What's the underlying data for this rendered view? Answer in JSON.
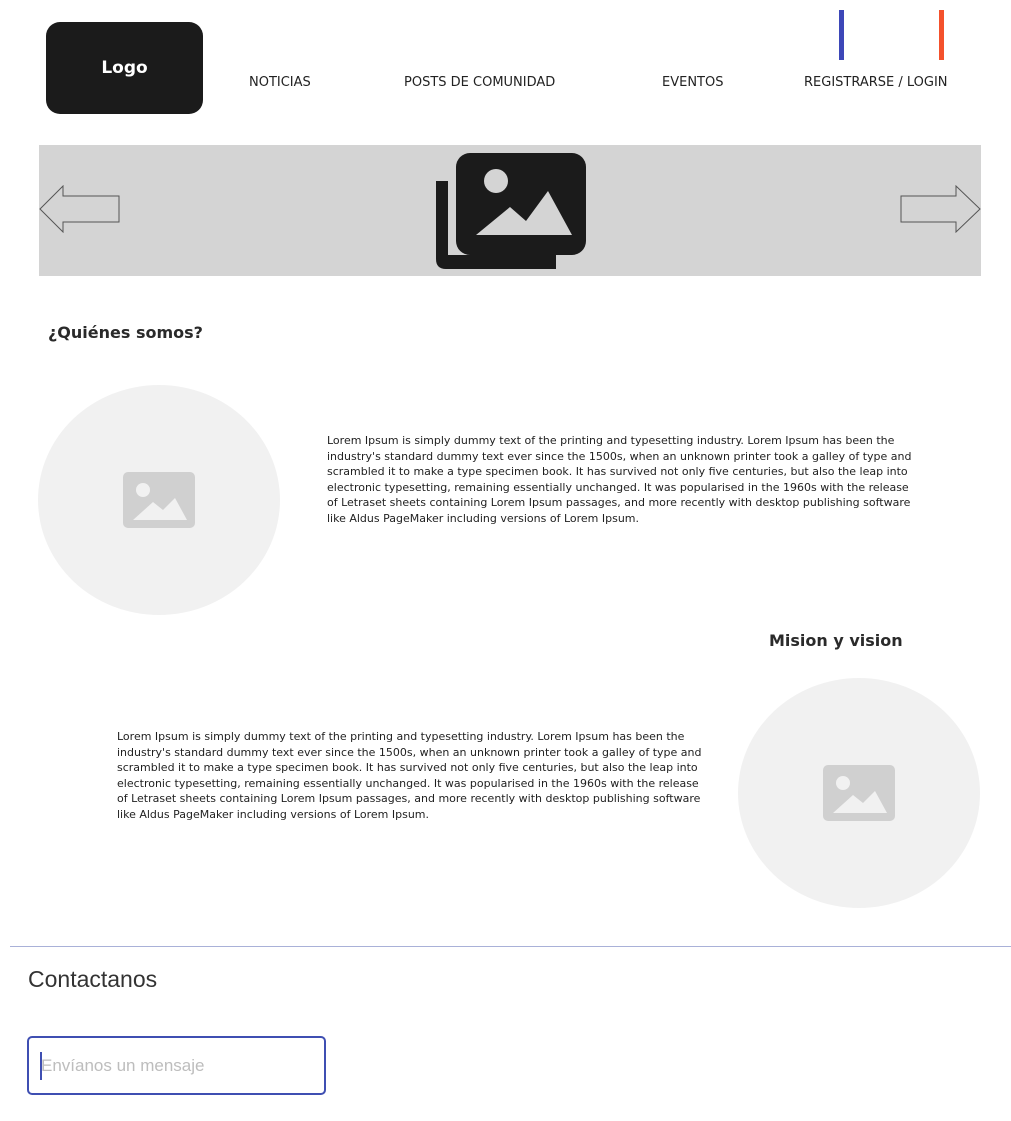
{
  "header": {
    "logo_label": "Logo",
    "nav": [
      {
        "label": "NOTICIAS"
      },
      {
        "label": "POSTS DE COMUNIDAD"
      },
      {
        "label": "EVENTOS"
      },
      {
        "label": "REGISTRARSE / LOGIN"
      }
    ],
    "accent_colors": [
      "#3d47b8",
      "#f4512c"
    ]
  },
  "carousel": {
    "prev_icon": "arrow-left-outline-icon",
    "next_icon": "arrow-right-outline-icon",
    "image_icon": "photo-library-icon",
    "background": "#d4d4d4"
  },
  "about": {
    "title": "¿Quiénes somos?",
    "text": "Lorem Ipsum is simply dummy text of the printing and typesetting industry. Lorem Ipsum has been the industry's standard dummy text ever since the 1500s, when an unknown printer took a galley of type and scrambled it to make a type specimen book. It has survived not only five centuries, but also the leap into electronic typesetting, remaining essentially unchanged. It was popularised in the 1960s with the release of Letraset sheets containing Lorem Ipsum passages, and more recently with desktop publishing software like Aldus PageMaker including versions of Lorem Ipsum.",
    "image_icon": "image-placeholder-icon"
  },
  "mission": {
    "title": "Mision y vision",
    "text": "Lorem Ipsum is simply dummy text of the printing and typesetting industry. Lorem Ipsum has been the industry's standard dummy text ever since the 1500s, when an unknown printer took a galley of type and scrambled it to make a type specimen book. It has survived not only five centuries, but also the leap into electronic typesetting, remaining essentially unchanged. It was popularised in the 1960s with the release of Letraset sheets containing Lorem Ipsum passages, and more recently with desktop publishing software like Aldus PageMaker including versions of Lorem Ipsum.",
    "image_icon": "image-placeholder-icon"
  },
  "contact": {
    "title": "Contactanos",
    "input_placeholder": "Envíanos un mensaje",
    "input_value": "",
    "accent_color": "#3f4fb2"
  }
}
